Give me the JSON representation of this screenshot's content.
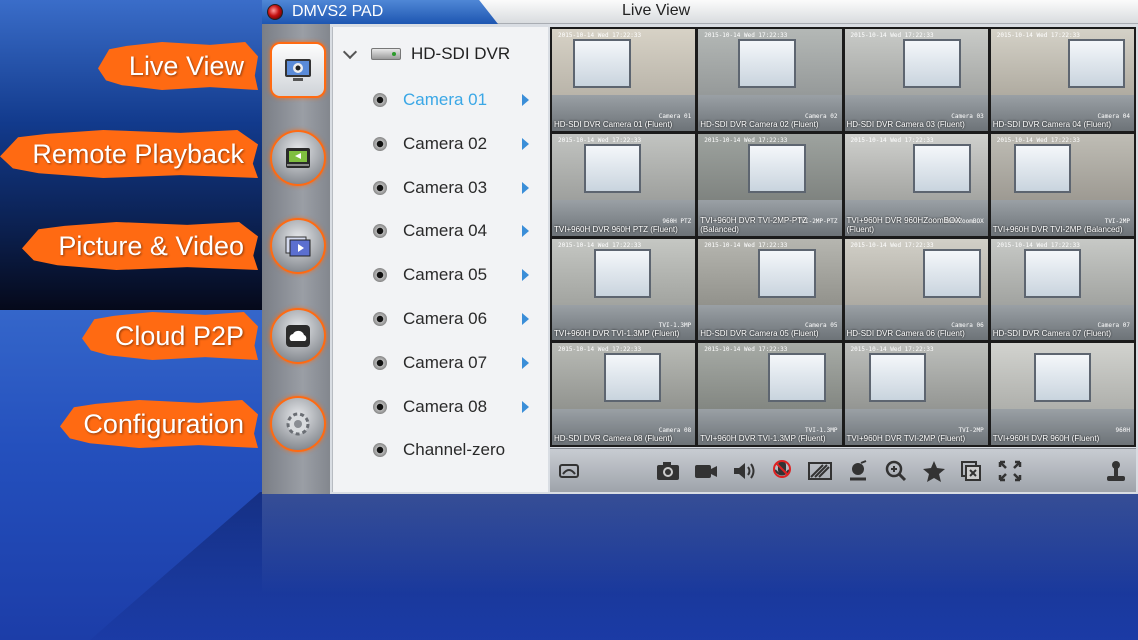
{
  "callouts": {
    "live_view": "Live View",
    "remote_playback": "Remote Playback",
    "picture_video": "Picture & Video",
    "cloud_p2p": "Cloud P2P",
    "configuration": "Configuration"
  },
  "app": {
    "name": "DMVS2 PAD",
    "title": "Live View"
  },
  "tree": {
    "root": "HD-SDI DVR",
    "cameras": [
      "Camera 01",
      "Camera 02",
      "Camera 03",
      "Camera 04",
      "Camera 05",
      "Camera 06",
      "Camera 07",
      "Camera 08",
      "Channel-zero"
    ],
    "active_index": 0
  },
  "tiles": [
    {
      "caption": "HD-SDI DVR Camera 01 (Fluent)",
      "timestamp": "2015-10-14 Wed 17:22:33",
      "tag": "Camera 01"
    },
    {
      "caption": "HD-SDI DVR Camera 02 (Fluent)",
      "timestamp": "2015-10-14 Wed 17:22:33",
      "tag": "Camera 02"
    },
    {
      "caption": "HD-SDI DVR Camera 03 (Fluent)",
      "timestamp": "2015-10-14 Wed 17:22:33",
      "tag": "Camera 03"
    },
    {
      "caption": "HD-SDI DVR Camera 04 (Fluent)",
      "timestamp": "2015-10-14 Wed 17:22:33",
      "tag": "Camera 04"
    },
    {
      "caption": "TVI+960H DVR 960H PTZ (Fluent)",
      "timestamp": "2015-10-14 Wed 17:22:33",
      "tag": "960H PTZ"
    },
    {
      "caption": "TVI+960H DVR TVI-2MP-PTZ\n(Balanced)",
      "timestamp": "2015-10-14 Wed 17:22:33",
      "tag": "TVI-2MP-PTZ"
    },
    {
      "caption": "TVI+960H DVR 960HZoomBOX\n(Fluent)",
      "timestamp": "2015-10-14 Wed 17:22:33",
      "tag": "960HZoomBOX"
    },
    {
      "caption": "TVI+960H DVR TVI-2MP (Balanced)",
      "timestamp": "2015-10-14 Wed 17:22:33",
      "tag": "TVI-2MP"
    },
    {
      "caption": "TVI+960H DVR TVI-1.3MP (Fluent)",
      "timestamp": "2015-10-14 Wed 17:22:33",
      "tag": "TVI-1.3MP"
    },
    {
      "caption": "HD-SDI DVR Camera 05 (Fluent)",
      "timestamp": "2015-10-14 Wed 17:22:33",
      "tag": "Camera 05"
    },
    {
      "caption": "HD-SDI DVR Camera 06 (Fluent)",
      "timestamp": "2015-10-14 Wed 17:22:33",
      "tag": "Camera 06"
    },
    {
      "caption": "HD-SDI DVR Camera 07 (Fluent)",
      "timestamp": "2015-10-14 Wed 17:22:33",
      "tag": "Camera 07"
    },
    {
      "caption": "HD-SDI DVR Camera 08 (Fluent)",
      "timestamp": "2015-10-14 Wed 17:22:33",
      "tag": "Camera 08"
    },
    {
      "caption": "TVI+960H DVR TVI-1.3MP (Fluent)",
      "timestamp": "2015-10-14 Wed 17:22:33",
      "tag": "TVI-1.3MP"
    },
    {
      "caption": "TVI+960H DVR TVI-2MP (Fluent)",
      "timestamp": "2015-10-14 Wed 17:22:33",
      "tag": "TVI-2MP"
    },
    {
      "caption": "TVI+960H DVR 960H (Fluent)",
      "timestamp": "",
      "tag": "960H"
    }
  ],
  "colors": {
    "accent_orange": "#ff6a12",
    "active_camera": "#3aa7e6",
    "title_tab": "#1e56b1"
  }
}
